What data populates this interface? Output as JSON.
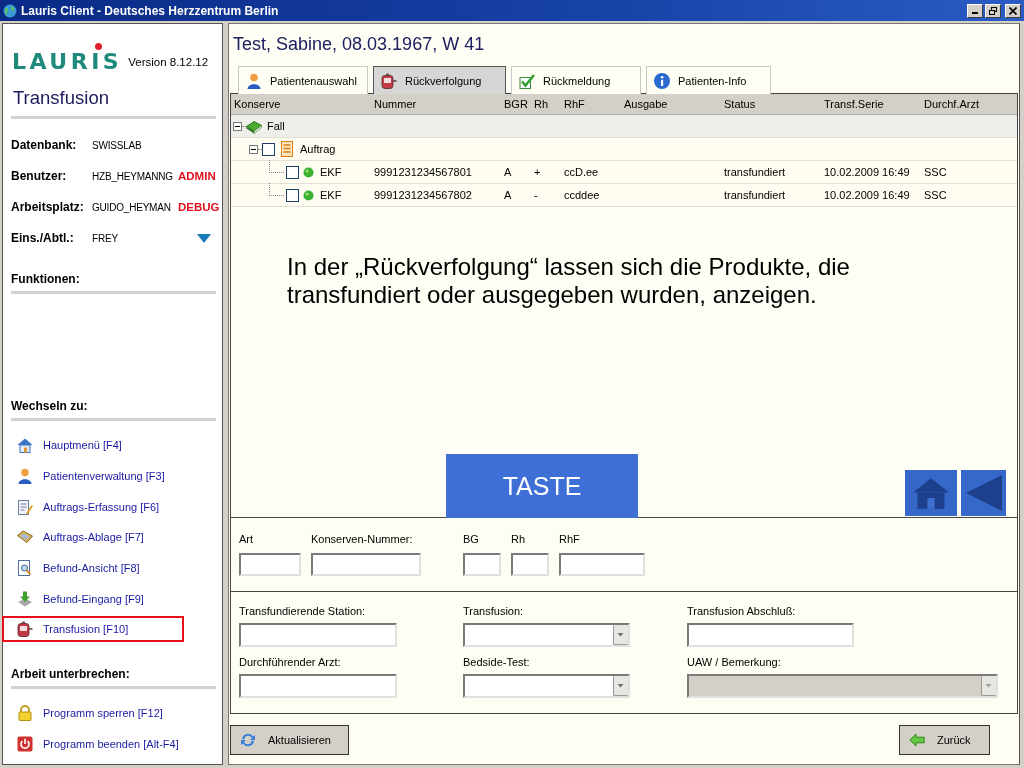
{
  "window": {
    "title": "Lauris Client - Deutsches Herzzentrum Berlin"
  },
  "sidebar": {
    "logo": "LAURIS",
    "version": "Version 8.12.12",
    "module": "Transfusion",
    "info": [
      {
        "label": "Datenbank:",
        "value": "SWISSLAB",
        "kind": "text"
      },
      {
        "label": "Benutzer:",
        "value": "HZB_HEYMANNG",
        "flag": "ADMIN",
        "kind": "text"
      },
      {
        "label": "Arbeitsplatz:",
        "value": "GUIDO_HEYMAN",
        "flag": "DEBUG",
        "kind": "text"
      },
      {
        "label": "Eins./Abtl.:",
        "value": "FREY",
        "kind": "dropdown"
      }
    ],
    "sections": [
      {
        "heading": "Funktionen:"
      },
      {
        "heading": "Wechseln zu:",
        "items": [
          {
            "label": "Hauptmenü [F4]",
            "kind": "home",
            "selected": false
          },
          {
            "label": "Patientenverwaltung [F3]",
            "kind": "person",
            "selected": false
          },
          {
            "label": "Auftrags-Erfassung [F6]",
            "kind": "edit",
            "selected": false
          },
          {
            "label": "Auftrags-Ablage [F7]",
            "kind": "archive",
            "selected": false
          },
          {
            "label": "Befund-Ansicht [F8]",
            "kind": "viewer",
            "selected": false
          },
          {
            "label": "Befund-Eingang [F9]",
            "kind": "inbox",
            "selected": false
          },
          {
            "label": "Transfusion [F10]",
            "kind": "transfusion",
            "selected": true
          }
        ]
      },
      {
        "heading": "Arbeit unterbrechen:",
        "items": [
          {
            "label": "Programm sperren [F12]",
            "kind": "lock",
            "selected": false
          },
          {
            "label": "Programm beenden [Alt-F4]",
            "kind": "power",
            "selected": false
          }
        ]
      }
    ]
  },
  "main": {
    "patient": "Test, Sabine, 08.03.1967, W 41",
    "tabs": [
      {
        "label": "Patientenauswahl",
        "kind": "person",
        "selected": false
      },
      {
        "label": "Rückverfolgung",
        "kind": "transfusion",
        "selected": true
      },
      {
        "label": "Rückmeldung",
        "kind": "check",
        "selected": false
      },
      {
        "label": "Patienten-Info",
        "kind": "info",
        "selected": false
      }
    ],
    "table": {
      "columns": [
        "Konserve",
        "Nummer",
        "BGR",
        "Rh",
        "RhF",
        "Ausgabe",
        "Status",
        "Transf.Serie",
        "Durchf.Arzt"
      ],
      "rows": [
        {
          "kind": "case",
          "label": "Fall",
          "expanded": true,
          "selected": true,
          "children": [
            {
              "kind": "order",
              "label": "Auftrag",
              "expanded": true,
              "checked": false,
              "selected": false,
              "children": [
                {
                  "kind": "unit",
                  "label": "EKF",
                  "checked": false,
                  "selected": false,
                  "cells": [
                    "9991231234567801",
                    "A",
                    "+",
                    "ccD.ee",
                    null,
                    "transfundiert",
                    "10.02.2009 16:49",
                    "SSC"
                  ]
                },
                {
                  "kind": "unit",
                  "label": "EKF",
                  "checked": false,
                  "selected": false,
                  "cells": [
                    "9991231234567802",
                    "A",
                    "-",
                    "ccddee",
                    null,
                    "transfundiert",
                    "10.02.2009 16:49",
                    "SSC"
                  ]
                }
              ]
            }
          ]
        }
      ]
    },
    "annotation": "In der „Rückverfolgung“ lassen sich die Produkte, die transfundiert oder ausgegeben wurden, anzeigen.",
    "key_button": "TASTE",
    "unit_fields": [
      {
        "label": "Art"
      },
      {
        "label": "Konserven-Nummer:"
      },
      {
        "label": "BG"
      },
      {
        "label": "Rh"
      },
      {
        "label": "RhF"
      }
    ],
    "transfusion_fields": [
      {
        "label": "Transfundierende Station:",
        "kind": "text",
        "disabled": false
      },
      {
        "label": "Transfusion:",
        "kind": "combo",
        "disabled": false
      },
      {
        "label": "Transfusion Abschluß:",
        "kind": "text",
        "disabled": false
      },
      {
        "label": "Durchführender Arzt:",
        "kind": "text",
        "disabled": false
      },
      {
        "label": "Bedside-Test:",
        "kind": "combo",
        "disabled": false
      },
      {
        "label": "UAW / Bemerkung:",
        "kind": "combo",
        "disabled": true
      }
    ],
    "buttons": [
      {
        "label": "Aktualisieren",
        "kind": "refresh"
      },
      {
        "label": "Zurück",
        "kind": "back"
      }
    ]
  }
}
